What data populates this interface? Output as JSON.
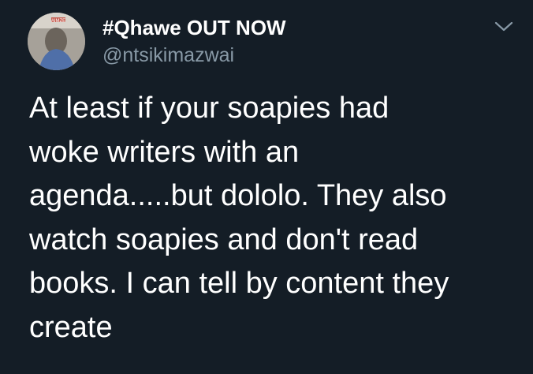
{
  "tweet": {
    "author": {
      "display_name": "#Qhawe OUT NOW",
      "handle": "@ntsikimazwai",
      "avatar_badge": "AIMZE"
    },
    "menu_icon": "chevron-down-icon",
    "text_lines": [
      "At least if your soapies had",
      "woke writers with an",
      "agenda.....but dololo. They also",
      "watch soapies and don't read",
      "books. I can tell by content they",
      "create"
    ]
  },
  "colors": {
    "background": "#141d26",
    "primary_text": "#ffffff",
    "secondary_text": "#8899a6"
  }
}
